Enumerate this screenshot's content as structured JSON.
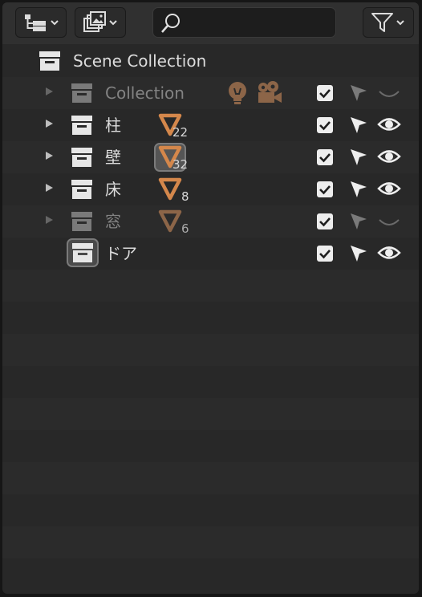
{
  "header": {
    "display_mode_icon": "outliner-tree-icon",
    "filter_type_icon": "image-stack-icon",
    "search": {
      "value": "",
      "placeholder": ""
    },
    "filter_icon": "funnel-icon"
  },
  "outliner": {
    "scene_collection": {
      "label": "Scene Collection"
    },
    "rows": [
      {
        "label": "Collection",
        "excluded": true,
        "extra_icons": [
          "light-icon",
          "camera-icon"
        ],
        "checked": true
      },
      {
        "label": "柱",
        "mesh_count": "22",
        "checked": true
      },
      {
        "label": "壁",
        "mesh_count": "32",
        "mesh_selected": true,
        "checked": true
      },
      {
        "label": "床",
        "mesh_count": "8",
        "checked": true
      },
      {
        "label": "窓",
        "mesh_count": "6",
        "excluded": true,
        "checked": true
      },
      {
        "label": "ドア",
        "active": true,
        "checked": true
      }
    ]
  },
  "colors": {
    "mesh_orange": "#d4874b",
    "mesh_orange_dim": "#8c6548",
    "background": "#282828",
    "header": "#303030"
  }
}
